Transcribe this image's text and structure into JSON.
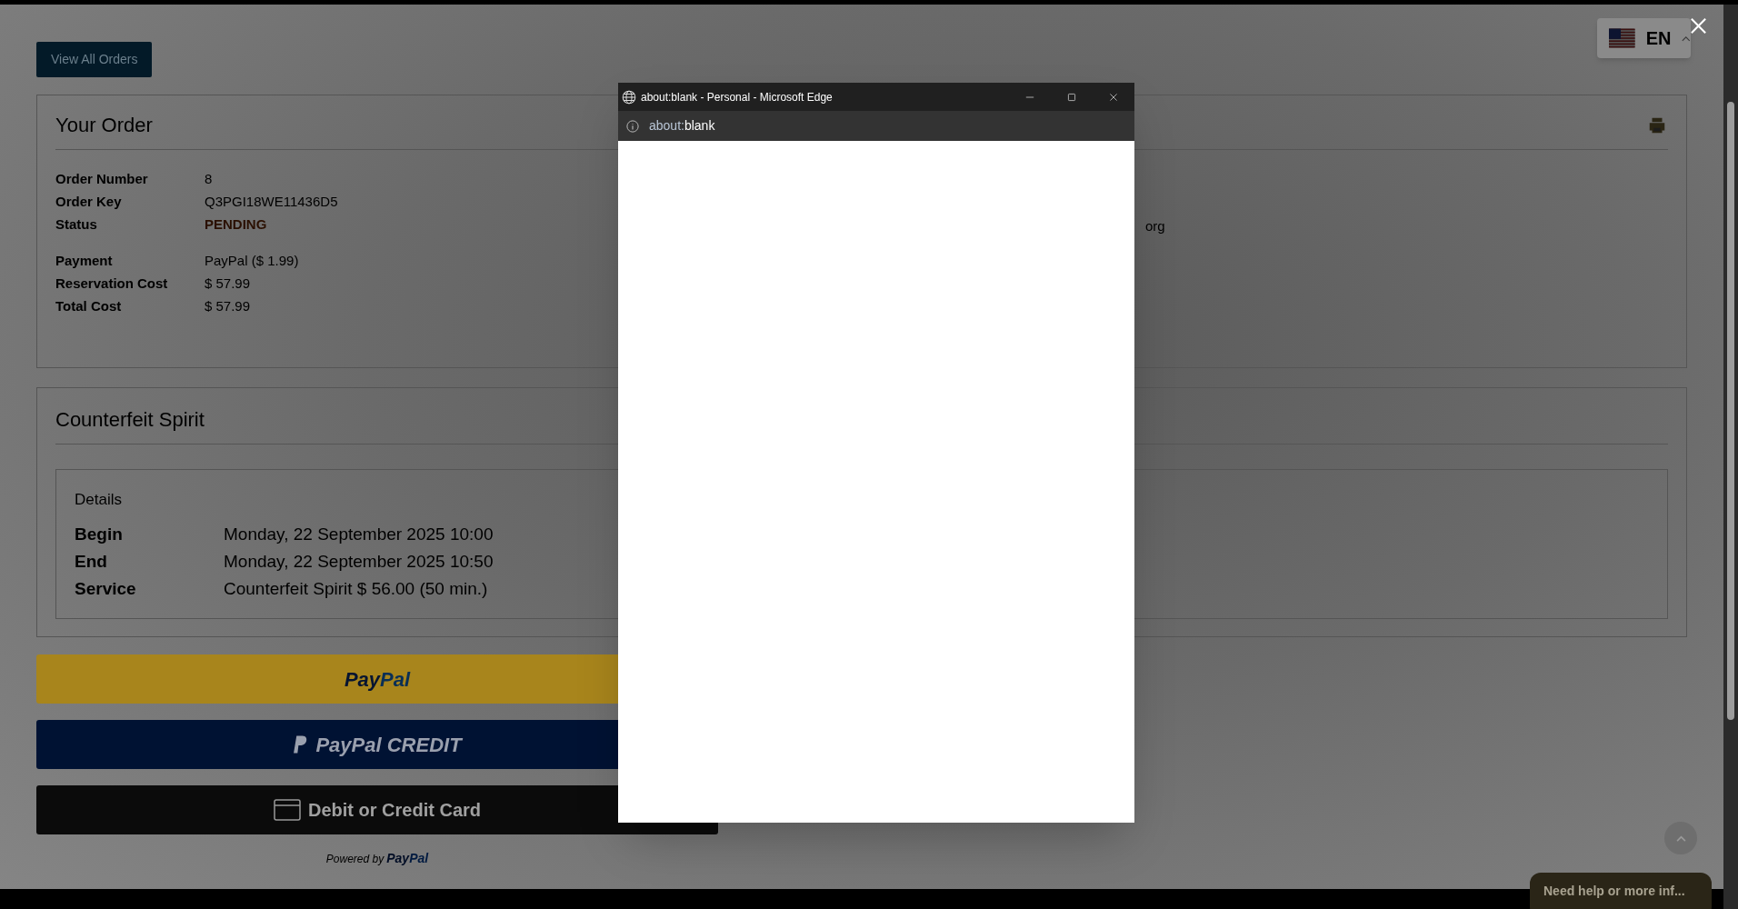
{
  "view_all_button": "View All Orders",
  "order": {
    "title": "Your Order",
    "row_groups": [
      {
        "rows": [
          {
            "label": "Order Number",
            "value": "8",
            "kind": "plain"
          },
          {
            "label": "Order Key",
            "value": "Q3PGI18WE11436D5",
            "kind": "plain"
          },
          {
            "label": "Status",
            "value": "PENDING",
            "kind": "status"
          }
        ]
      },
      {
        "rows": [
          {
            "label": "Payment",
            "value": "PayPal ($ 1.99)",
            "kind": "plain"
          },
          {
            "label": "Reservation Cost",
            "value": "$ 57.99",
            "kind": "plain"
          },
          {
            "label": "Total Cost",
            "value": "$ 57.99",
            "kind": "plain"
          }
        ]
      }
    ],
    "side_text": "org"
  },
  "service": {
    "title": "Counterfeit Spirit",
    "details": {
      "title": "Details",
      "rows": [
        {
          "label": "Begin",
          "value": "Monday, 22 September 2025 10:00"
        },
        {
          "label": "End",
          "value": "Monday, 22 September 2025 10:50"
        },
        {
          "label": "Service",
          "value": "Counterfeit Spirit $ 56.00 (50 min.)"
        }
      ]
    }
  },
  "payment_buttons": [
    {
      "kind": "paypal",
      "parts": [
        "Pay",
        "Pal"
      ]
    },
    {
      "kind": "paypal_credit",
      "parts": [
        "PayPal CREDIT"
      ]
    },
    {
      "kind": "card",
      "parts": [
        "Debit or Credit Card"
      ]
    }
  ],
  "powered_by": {
    "prefix": "Powered by",
    "brand": [
      "Pay",
      "Pal"
    ]
  },
  "language": {
    "code": "EN"
  },
  "chat": {
    "text": "Need help or more inf..."
  },
  "popup": {
    "title": "about:blank - Personal - Microsoft Edge",
    "address": [
      "about:",
      "blank"
    ]
  }
}
